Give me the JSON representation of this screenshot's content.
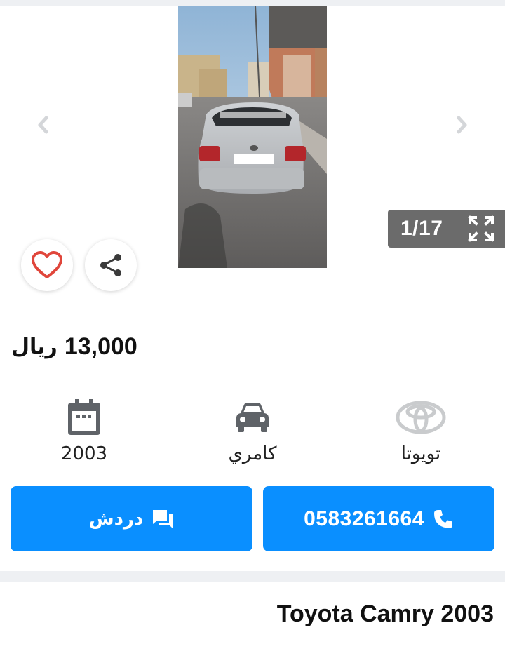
{
  "gallery": {
    "counter": "1/17",
    "icons": {
      "prev": "chevron-left-icon",
      "next": "chevron-right-icon",
      "expand": "fullscreen-icon"
    }
  },
  "actions_round": {
    "favorite_icon": "heart-icon",
    "share_icon": "share-icon"
  },
  "price": {
    "value": "13,000",
    "currency": "ريال"
  },
  "specs": {
    "year": {
      "icon": "calendar-icon",
      "value": "2003"
    },
    "model": {
      "icon": "car-icon",
      "value": "كامري"
    },
    "make": {
      "icon": "toyota-logo-icon",
      "value": "تويوتا"
    }
  },
  "buttons": {
    "chat": {
      "label": "دردش",
      "icon": "chat-icon"
    },
    "call": {
      "label": "0583261664",
      "icon": "phone-icon"
    }
  },
  "listing": {
    "title": "Toyota Camry 2003"
  },
  "colors": {
    "accent": "#0a8fff",
    "heart": "#e0463b",
    "counter_bg": "#6b6b6b"
  }
}
